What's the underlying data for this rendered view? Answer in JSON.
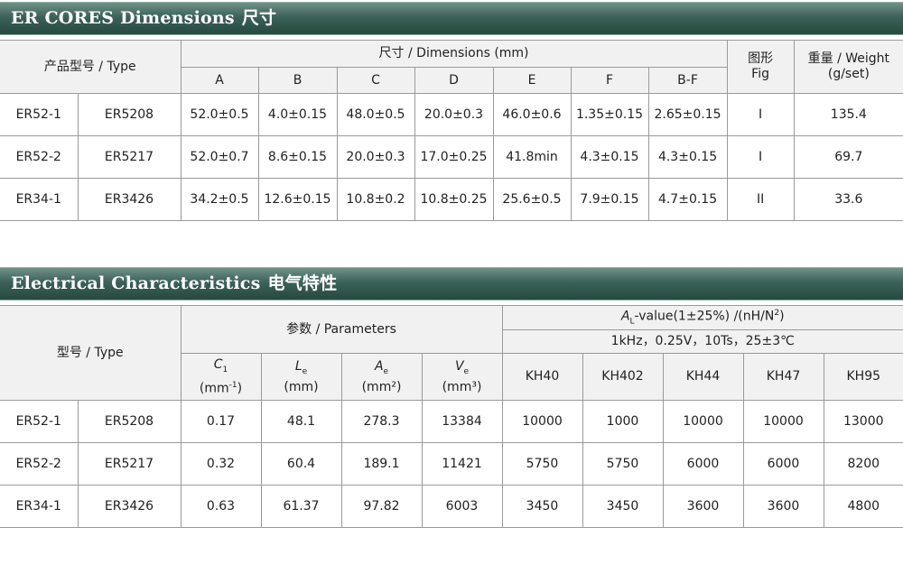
{
  "section1": {
    "title": "ER CORES Dimensions",
    "title_cn": "尺寸",
    "header": {
      "type": "产品型号 / Type",
      "dimensions": "尺寸 / Dimensions (mm)",
      "fig_cn": "图形",
      "fig_en": "Fig",
      "weight_line1": "重量 / Weight",
      "weight_line2": "(g/set)",
      "columns": [
        "A",
        "B",
        "C",
        "D",
        "E",
        "F",
        "B-F"
      ]
    },
    "rows": [
      {
        "model": "ER52-1",
        "type": "ER5208",
        "values": [
          "52.0±0.5",
          "4.0±0.15",
          "48.0±0.5",
          "20.0±0.3",
          "46.0±0.6",
          "1.35±0.15",
          "2.65±0.15"
        ],
        "fig": "I",
        "weight": "135.4"
      },
      {
        "model": "ER52-2",
        "type": "ER5217",
        "values": [
          "52.0±0.7",
          "8.6±0.15",
          "20.0±0.3",
          "17.0±0.25",
          "41.8min",
          "4.3±0.15",
          "4.3±0.15"
        ],
        "fig": "I",
        "weight": "69.7"
      },
      {
        "model": "ER34-1",
        "type": "ER3426",
        "values": [
          "34.2±0.5",
          "12.6±0.15",
          "10.8±0.2",
          "10.8±0.25",
          "25.6±0.5",
          "7.9±0.15",
          "4.7±0.15"
        ],
        "fig": "II",
        "weight": "33.6"
      }
    ]
  },
  "section2": {
    "title": "Electrical Characteristics",
    "title_cn": "电气特性",
    "header": {
      "type": "型号 / Type",
      "parameters": "参数 / Parameters",
      "al_symbol": "A",
      "al_sub": "L",
      "al_text": "-value(1±25%) /(nH/N",
      "al_sup": "2",
      "al_close": ")",
      "conditions": "1kHz，0.25V，10Ts，25±3℃",
      "params": [
        {
          "sym": "C",
          "sub": "1",
          "unit_pre": "(mm",
          "unit_sup": "-1",
          "unit_post": ")"
        },
        {
          "sym": "L",
          "sub": "e",
          "unit_pre": "(mm)",
          "unit_sup": "",
          "unit_post": ""
        },
        {
          "sym": "A",
          "sub": "e",
          "unit_pre": "(mm²)",
          "unit_sup": "",
          "unit_post": ""
        },
        {
          "sym": "V",
          "sub": "e",
          "unit_pre": "(mm³)",
          "unit_sup": "",
          "unit_post": ""
        }
      ],
      "materials": [
        "KH40",
        "KH402",
        "KH44",
        "KH47",
        "KH95"
      ]
    },
    "rows": [
      {
        "model": "ER52-1",
        "type": "ER5208",
        "params": [
          "0.17",
          "48.1",
          "278.3",
          "13384"
        ],
        "al": [
          "10000",
          "1000",
          "10000",
          "10000",
          "13000"
        ]
      },
      {
        "model": "ER52-2",
        "type": "ER5217",
        "params": [
          "0.32",
          "60.4",
          "189.1",
          "11421"
        ],
        "al": [
          "5750",
          "5750",
          "6000",
          "6000",
          "8200"
        ]
      },
      {
        "model": "ER34-1",
        "type": "ER3426",
        "params": [
          "0.63",
          "61.37",
          "97.82",
          "6003"
        ],
        "al": [
          "3450",
          "3450",
          "3600",
          "3600",
          "4800"
        ]
      }
    ]
  }
}
